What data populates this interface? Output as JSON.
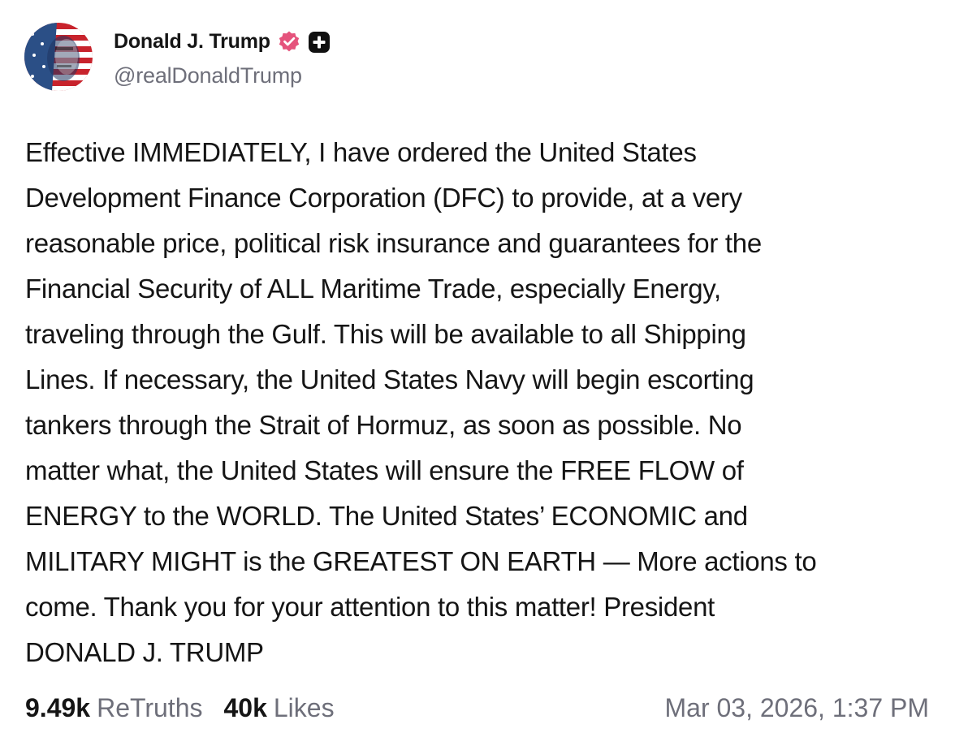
{
  "author": {
    "display_name": "Donald J. Trump",
    "handle": "@realDonaldTrump",
    "avatar_icon": "flag-portrait-avatar",
    "verified_icon": "verified-badge-icon",
    "plus_icon": "plus-badge-icon"
  },
  "post": {
    "text": "Effective IMMEDIATELY, I have ordered the United States\nDevelopment Finance Corporation (DFC) to provide, at a very\nreasonable price, political risk insurance and guarantees for the\nFinancial Security of ALL Maritime Trade, especially Energy,\ntraveling through the Gulf. This will be available to all Shipping\nLines. If necessary, the United States Navy will begin escorting\ntankers through the Strait of Hormuz, as soon as possible. No\nmatter what, the United States will ensure the FREE FLOW of\nENERGY to the WORLD. The United States’ ECONOMIC and\nMILITARY MIGHT is the GREATEST ON EARTH — More actions to\ncome. Thank you for your attention to this matter! President\nDONALD J. TRUMP"
  },
  "stats": {
    "retruths_count": "9.49k",
    "retruths_label": "ReTruths",
    "likes_count": "40k",
    "likes_label": "Likes"
  },
  "timestamp": "Mar 03, 2026, 1:37 PM",
  "colors": {
    "text": "#151515",
    "muted": "#6e6f7a",
    "verified": "#e5537c",
    "badge": "#111111"
  }
}
